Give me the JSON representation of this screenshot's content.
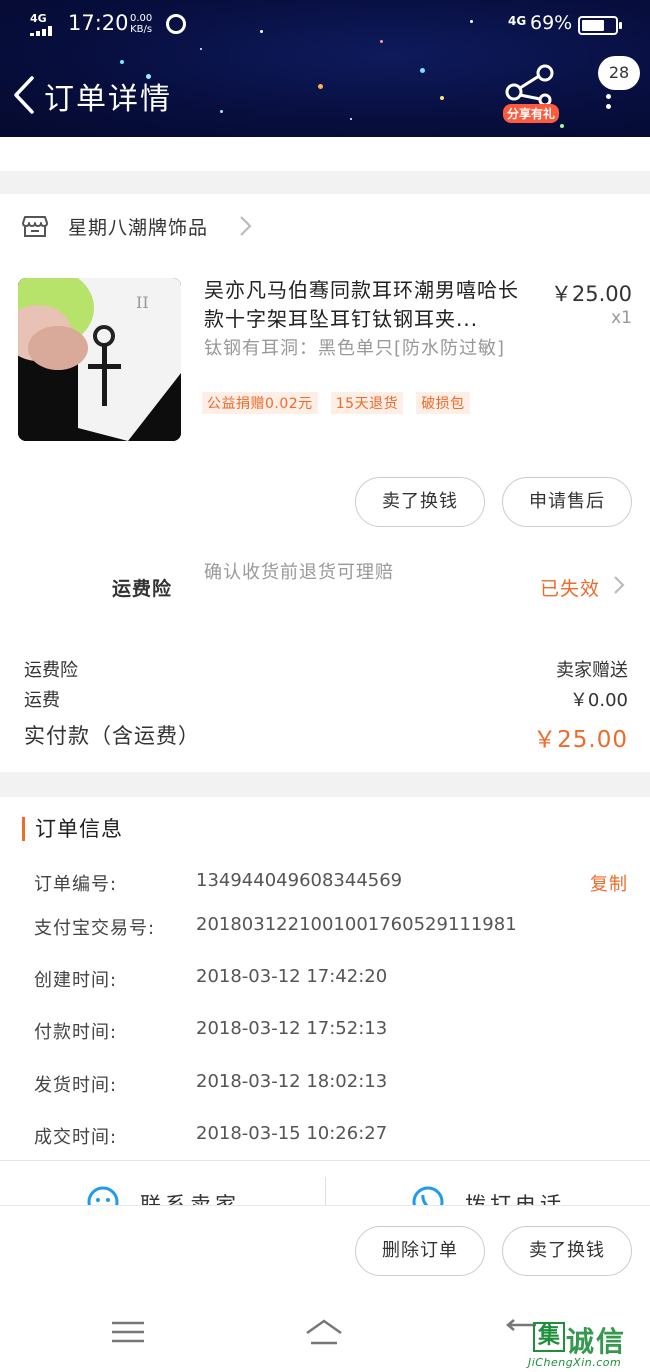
{
  "status_bar": {
    "signal": "4G",
    "time": "17:20",
    "speed_value": "0.00",
    "speed_unit": "KB/s",
    "network": "4G",
    "battery": "69%",
    "battery_level": 0.69
  },
  "header": {
    "title": "订单详情",
    "share_label": "分享有礼",
    "badge_count": "28"
  },
  "shop": {
    "name": "星期八潮牌饰品"
  },
  "product": {
    "title": "吴亦凡马伯骞同款耳环潮男嘻哈长款十字架耳坠耳钉钛钢耳夹...",
    "spec": "钛钢有耳洞：黑色单只[防水防过敏]",
    "price": "￥25.00",
    "qty": "x1",
    "tags": [
      "公益捐赠0.02元",
      "15天退货",
      "破损包"
    ]
  },
  "actions": {
    "sell_label": "卖了换钱",
    "after_sale_label": "申请售后"
  },
  "insurance": {
    "label": "运费险",
    "desc": "确认收货前退货可理赔",
    "status": "已失效"
  },
  "fees": {
    "insurance_label": "运费险",
    "insurance_value": "卖家赠送",
    "shipping_label": "运费",
    "shipping_value": "￥0.00",
    "total_label": "实付款（含运费）",
    "total_value": "￥25.00"
  },
  "order_info": {
    "heading": "订单信息",
    "copy_label": "复制",
    "rows": [
      {
        "key": "订单编号:",
        "value": "134944049608344569"
      },
      {
        "key": "支付宝交易号:",
        "value": "2018031221001001760529111981"
      },
      {
        "key": "创建时间:",
        "value": "2018-03-12 17:42:20"
      },
      {
        "key": "付款时间:",
        "value": "2018-03-12 17:52:13"
      },
      {
        "key": "发货时间:",
        "value": "2018-03-12 18:02:13"
      },
      {
        "key": "成交时间:",
        "value": "2018-03-15 10:26:27"
      }
    ]
  },
  "contact": {
    "seller_label": "联系卖家",
    "phone_label": "拨打电话"
  },
  "bottom_actions": {
    "delete_label": "删除订单",
    "sell_label": "卖了换钱"
  },
  "watermark": {
    "char1": "集",
    "text": "诚信",
    "url": "JiChengXin.com"
  },
  "colors": {
    "accent": "#f06a2a",
    "header_bg": "#070e3d",
    "share_badge": "#ff5a3c"
  }
}
